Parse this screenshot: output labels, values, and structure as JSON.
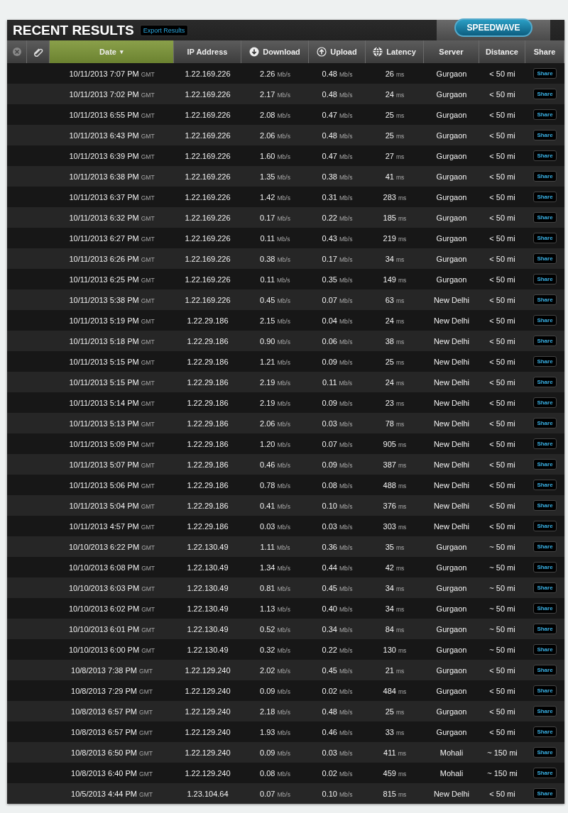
{
  "title": "RECENT RESULTS",
  "export_button": "Export Results",
  "brand_button": "SPEEDWAVE",
  "columns": [
    {
      "kind": "clear",
      "selected": false
    },
    {
      "kind": "tag",
      "selected": false
    },
    {
      "kind": "text",
      "label": "Date",
      "sort_indicator": "▾",
      "selected": true
    },
    {
      "kind": "text",
      "label": "IP Address",
      "selected": false
    },
    {
      "kind": "down",
      "label": "Download",
      "selected": false
    },
    {
      "kind": "up",
      "label": "Upload",
      "selected": false
    },
    {
      "kind": "globe",
      "label": "Latency",
      "selected": false
    },
    {
      "kind": "text",
      "label": "Server",
      "selected": false
    },
    {
      "kind": "text",
      "label": "Distance",
      "selected": false
    },
    {
      "kind": "text",
      "label": "Share",
      "selected": false
    }
  ],
  "rows": [
    {
      "date": "10/11/2013 7:07 PM GMT",
      "ip": "1.22.169.226",
      "download": "2.26 Mb/s",
      "upload": "0.48 Mb/s",
      "latency": "26 ms",
      "server": "Gurgaon",
      "distance": "< 50 mi",
      "share": "Share"
    },
    {
      "date": "10/11/2013 7:02 PM GMT",
      "ip": "1.22.169.226",
      "download": "2.17 Mb/s",
      "upload": "0.48 Mb/s",
      "latency": "24 ms",
      "server": "Gurgaon",
      "distance": "< 50 mi",
      "share": "Share"
    },
    {
      "date": "10/11/2013 6:55 PM GMT",
      "ip": "1.22.169.226",
      "download": "2.08 Mb/s",
      "upload": "0.47 Mb/s",
      "latency": "25 ms",
      "server": "Gurgaon",
      "distance": "< 50 mi",
      "share": "Share"
    },
    {
      "date": "10/11/2013 6:43 PM GMT",
      "ip": "1.22.169.226",
      "download": "2.06 Mb/s",
      "upload": "0.48 Mb/s",
      "latency": "25 ms",
      "server": "Gurgaon",
      "distance": "< 50 mi",
      "share": "Share"
    },
    {
      "date": "10/11/2013 6:39 PM GMT",
      "ip": "1.22.169.226",
      "download": "1.60 Mb/s",
      "upload": "0.47 Mb/s",
      "latency": "27 ms",
      "server": "Gurgaon",
      "distance": "< 50 mi",
      "share": "Share"
    },
    {
      "date": "10/11/2013 6:38 PM GMT",
      "ip": "1.22.169.226",
      "download": "1.35 Mb/s",
      "upload": "0.38 Mb/s",
      "latency": "41 ms",
      "server": "Gurgaon",
      "distance": "< 50 mi",
      "share": "Share"
    },
    {
      "date": "10/11/2013 6:37 PM GMT",
      "ip": "1.22.169.226",
      "download": "1.42 Mb/s",
      "upload": "0.31 Mb/s",
      "latency": "283 ms",
      "server": "Gurgaon",
      "distance": "< 50 mi",
      "share": "Share"
    },
    {
      "date": "10/11/2013 6:32 PM GMT",
      "ip": "1.22.169.226",
      "download": "0.17 Mb/s",
      "upload": "0.22 Mb/s",
      "latency": "185 ms",
      "server": "Gurgaon",
      "distance": "< 50 mi",
      "share": "Share"
    },
    {
      "date": "10/11/2013 6:27 PM GMT",
      "ip": "1.22.169.226",
      "download": "0.11 Mb/s",
      "upload": "0.43 Mb/s",
      "latency": "219 ms",
      "server": "Gurgaon",
      "distance": "< 50 mi",
      "share": "Share"
    },
    {
      "date": "10/11/2013 6:26 PM GMT",
      "ip": "1.22.169.226",
      "download": "0.38 Mb/s",
      "upload": "0.17 Mb/s",
      "latency": "34 ms",
      "server": "Gurgaon",
      "distance": "< 50 mi",
      "share": "Share"
    },
    {
      "date": "10/11/2013 6:25 PM GMT",
      "ip": "1.22.169.226",
      "download": "0.11 Mb/s",
      "upload": "0.35 Mb/s",
      "latency": "149 ms",
      "server": "Gurgaon",
      "distance": "< 50 mi",
      "share": "Share"
    },
    {
      "date": "10/11/2013 5:38 PM GMT",
      "ip": "1.22.169.226",
      "download": "0.45 Mb/s",
      "upload": "0.07 Mb/s",
      "latency": "63 ms",
      "server": "New Delhi",
      "distance": "< 50 mi",
      "share": "Share"
    },
    {
      "date": "10/11/2013 5:19 PM GMT",
      "ip": "1.22.29.186",
      "download": "2.15 Mb/s",
      "upload": "0.04 Mb/s",
      "latency": "24 ms",
      "server": "New Delhi",
      "distance": "< 50 mi",
      "share": "Share"
    },
    {
      "date": "10/11/2013 5:18 PM GMT",
      "ip": "1.22.29.186",
      "download": "0.90 Mb/s",
      "upload": "0.06 Mb/s",
      "latency": "38 ms",
      "server": "New Delhi",
      "distance": "< 50 mi",
      "share": "Share"
    },
    {
      "date": "10/11/2013 5:15 PM GMT",
      "ip": "1.22.29.186",
      "download": "1.21 Mb/s",
      "upload": "0.09 Mb/s",
      "latency": "25 ms",
      "server": "New Delhi",
      "distance": "< 50 mi",
      "share": "Share"
    },
    {
      "date": "10/11/2013 5:15 PM GMT",
      "ip": "1.22.29.186",
      "download": "2.19 Mb/s",
      "upload": "0.11 Mb/s",
      "latency": "24 ms",
      "server": "New Delhi",
      "distance": "< 50 mi",
      "share": "Share"
    },
    {
      "date": "10/11/2013 5:14 PM GMT",
      "ip": "1.22.29.186",
      "download": "2.19 Mb/s",
      "upload": "0.09 Mb/s",
      "latency": "23 ms",
      "server": "New Delhi",
      "distance": "< 50 mi",
      "share": "Share"
    },
    {
      "date": "10/11/2013 5:13 PM GMT",
      "ip": "1.22.29.186",
      "download": "2.06 Mb/s",
      "upload": "0.03 Mb/s",
      "latency": "78 ms",
      "server": "New Delhi",
      "distance": "< 50 mi",
      "share": "Share"
    },
    {
      "date": "10/11/2013 5:09 PM GMT",
      "ip": "1.22.29.186",
      "download": "1.20 Mb/s",
      "upload": "0.07 Mb/s",
      "latency": "905 ms",
      "server": "New Delhi",
      "distance": "< 50 mi",
      "share": "Share"
    },
    {
      "date": "10/11/2013 5:07 PM GMT",
      "ip": "1.22.29.186",
      "download": "0.46 Mb/s",
      "upload": "0.09 Mb/s",
      "latency": "387 ms",
      "server": "New Delhi",
      "distance": "< 50 mi",
      "share": "Share"
    },
    {
      "date": "10/11/2013 5:06 PM GMT",
      "ip": "1.22.29.186",
      "download": "0.78 Mb/s",
      "upload": "0.08 Mb/s",
      "latency": "488 ms",
      "server": "New Delhi",
      "distance": "< 50 mi",
      "share": "Share"
    },
    {
      "date": "10/11/2013 5:04 PM GMT",
      "ip": "1.22.29.186",
      "download": "0.41 Mb/s",
      "upload": "0.10 Mb/s",
      "latency": "376 ms",
      "server": "New Delhi",
      "distance": "< 50 mi",
      "share": "Share"
    },
    {
      "date": "10/11/2013 4:57 PM GMT",
      "ip": "1.22.29.186",
      "download": "0.03 Mb/s",
      "upload": "0.03 Mb/s",
      "latency": "303 ms",
      "server": "New Delhi",
      "distance": "< 50 mi",
      "share": "Share"
    },
    {
      "date": "10/10/2013 6:22 PM GMT",
      "ip": "1.22.130.49",
      "download": "1.11 Mb/s",
      "upload": "0.36 Mb/s",
      "latency": "35 ms",
      "server": "Gurgaon",
      "distance": "~ 50 mi",
      "share": "Share"
    },
    {
      "date": "10/10/2013 6:08 PM GMT",
      "ip": "1.22.130.49",
      "download": "1.34 Mb/s",
      "upload": "0.44 Mb/s",
      "latency": "42 ms",
      "server": "Gurgaon",
      "distance": "~ 50 mi",
      "share": "Share"
    },
    {
      "date": "10/10/2013 6:03 PM GMT",
      "ip": "1.22.130.49",
      "download": "0.81 Mb/s",
      "upload": "0.45 Mb/s",
      "latency": "34 ms",
      "server": "Gurgaon",
      "distance": "~ 50 mi",
      "share": "Share"
    },
    {
      "date": "10/10/2013 6:02 PM GMT",
      "ip": "1.22.130.49",
      "download": "1.13 Mb/s",
      "upload": "0.40 Mb/s",
      "latency": "34 ms",
      "server": "Gurgaon",
      "distance": "~ 50 mi",
      "share": "Share"
    },
    {
      "date": "10/10/2013 6:01 PM GMT",
      "ip": "1.22.130.49",
      "download": "0.52 Mb/s",
      "upload": "0.34 Mb/s",
      "latency": "84 ms",
      "server": "Gurgaon",
      "distance": "~ 50 mi",
      "share": "Share"
    },
    {
      "date": "10/10/2013 6:00 PM GMT",
      "ip": "1.22.130.49",
      "download": "0.32 Mb/s",
      "upload": "0.22 Mb/s",
      "latency": "130 ms",
      "server": "Gurgaon",
      "distance": "~ 50 mi",
      "share": "Share"
    },
    {
      "date": "10/8/2013 7:38 PM GMT",
      "ip": "1.22.129.240",
      "download": "2.02 Mb/s",
      "upload": "0.45 Mb/s",
      "latency": "21 ms",
      "server": "Gurgaon",
      "distance": "< 50 mi",
      "share": "Share"
    },
    {
      "date": "10/8/2013 7:29 PM GMT",
      "ip": "1.22.129.240",
      "download": "0.09 Mb/s",
      "upload": "0.02 Mb/s",
      "latency": "484 ms",
      "server": "Gurgaon",
      "distance": "< 50 mi",
      "share": "Share"
    },
    {
      "date": "10/8/2013 6:57 PM GMT",
      "ip": "1.22.129.240",
      "download": "2.18 Mb/s",
      "upload": "0.48 Mb/s",
      "latency": "25 ms",
      "server": "Gurgaon",
      "distance": "< 50 mi",
      "share": "Share"
    },
    {
      "date": "10/8/2013 6:57 PM GMT",
      "ip": "1.22.129.240",
      "download": "1.93 Mb/s",
      "upload": "0.46 Mb/s",
      "latency": "33 ms",
      "server": "Gurgaon",
      "distance": "< 50 mi",
      "share": "Share"
    },
    {
      "date": "10/8/2013 6:50 PM GMT",
      "ip": "1.22.129.240",
      "download": "0.09 Mb/s",
      "upload": "0.03 Mb/s",
      "latency": "411 ms",
      "server": "Mohali",
      "distance": "~ 150 mi",
      "share": "Share"
    },
    {
      "date": "10/8/2013 6:40 PM GMT",
      "ip": "1.22.129.240",
      "download": "0.08 Mb/s",
      "upload": "0.02 Mb/s",
      "latency": "459 ms",
      "server": "Mohali",
      "distance": "~ 150 mi",
      "share": "Share"
    },
    {
      "date": "10/5/2013 4:44 PM GMT",
      "ip": "1.23.104.64",
      "download": "0.07 Mb/s",
      "upload": "0.10 Mb/s",
      "latency": "815 ms",
      "server": "New Delhi",
      "distance": "< 50 mi",
      "share": "Share"
    }
  ]
}
